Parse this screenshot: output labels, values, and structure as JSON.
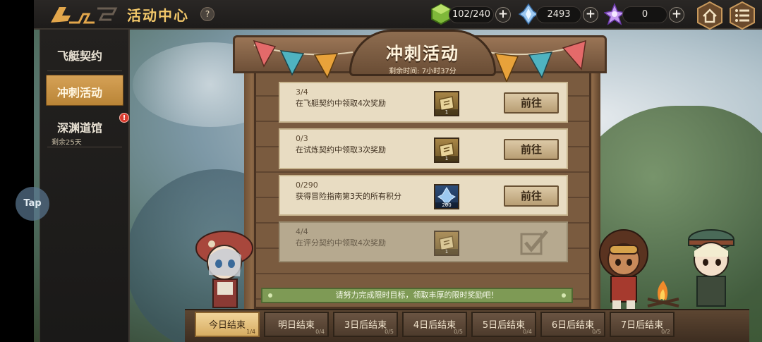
{
  "header": {
    "title": "活动中心",
    "help_label": "?",
    "stamina": "102/240",
    "crystal": "2493",
    "star_gem": "0",
    "plus_label": "+"
  },
  "sidebar": {
    "items": [
      {
        "label": "飞艇契约"
      },
      {
        "label": "冲刺活动"
      },
      {
        "label": "深渊道馆",
        "sub": "剩余25天",
        "alert": "!"
      }
    ]
  },
  "tap_bubble": "Tap",
  "board": {
    "title": "冲刺活动",
    "remaining": "剩余时间: 7小时37分"
  },
  "tasks": [
    {
      "progress": "3/4",
      "desc": "在飞艇契约中领取4次奖励",
      "reward_count": "1",
      "button": "前往"
    },
    {
      "progress": "0/3",
      "desc": "在试炼契约中领取3次奖励",
      "reward_count": "1",
      "button": "前往"
    },
    {
      "progress": "0/290",
      "desc": "获得冒险指南第3天的所有积分",
      "reward_count": "200",
      "button": "前往"
    },
    {
      "progress": "4/4",
      "desc": "在评分契约中领取4次奖励",
      "reward_count": "1"
    }
  ],
  "footer_banner": "请努力完成限时目标，领取丰厚的限时奖励吧！",
  "tabs": [
    {
      "label": "今日结束",
      "count": "1/4"
    },
    {
      "label": "明日结束",
      "count": "0/4"
    },
    {
      "label": "3日后结束",
      "count": "0/5"
    },
    {
      "label": "4日后结束",
      "count": "0/5"
    },
    {
      "label": "5日后结束",
      "count": "0/4"
    },
    {
      "label": "6日后结束",
      "count": "0/5"
    },
    {
      "label": "7日后结束",
      "count": "0/2"
    }
  ],
  "colors": {
    "accent_gold": "#f3c86a",
    "parchment": "#e8dcc2",
    "tab_active": "#d7ad62",
    "banner_green": "#7e9a55"
  }
}
